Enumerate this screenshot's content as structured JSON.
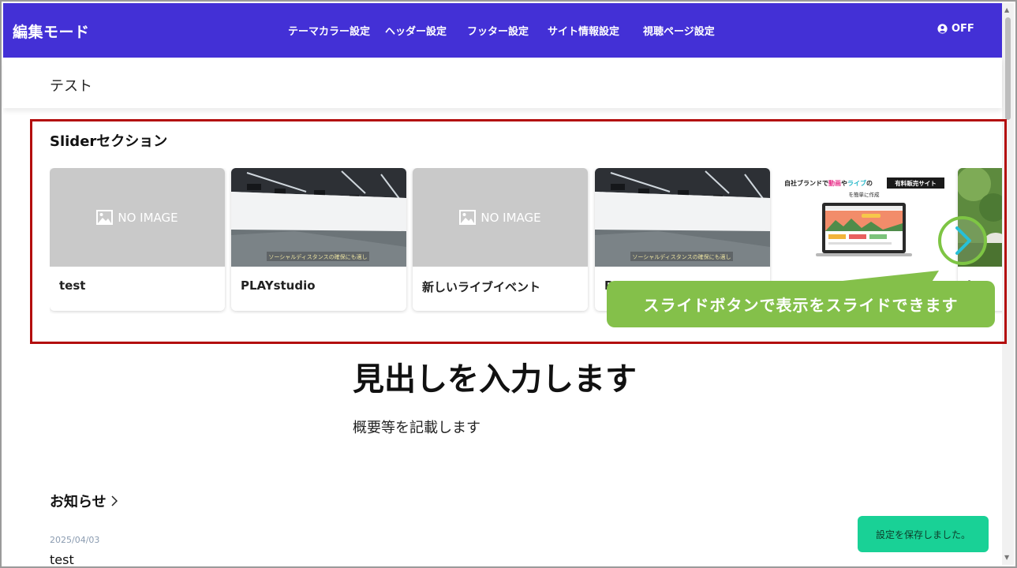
{
  "editbar": {
    "mode_label": "編集モード",
    "nav": [
      "テーマカラー設定",
      "ヘッダー設定",
      "フッター設定",
      "サイト情報設定",
      "視聴ページ設定"
    ],
    "toggle_label": "OFF",
    "background_color": "#4330d6"
  },
  "site_header": {
    "title": "テスト"
  },
  "slider_section": {
    "title": "Sliderセクション",
    "no_image_text": "NO IMAGE",
    "studio_caption": "ソーシャルディスタンスの確保にも適し",
    "promo": {
      "line1_prefix": "自社ブランドで",
      "line1_a": "動画",
      "line1_mid": "や",
      "line1_b": "ライブ",
      "line1_suffix": "の",
      "badge": "有料販売サイト",
      "line2": "を簡単に作成"
    },
    "cards": [
      {
        "label": "test",
        "image": "no-image"
      },
      {
        "label": "PLAYstudio",
        "image": "studio"
      },
      {
        "label": "新しいライブイベント",
        "image": "no-image"
      },
      {
        "label": "P",
        "image": "studio"
      },
      {
        "label": "",
        "image": "promo"
      },
      {
        "label": "bu",
        "image": "nature"
      }
    ],
    "next_button_icon": "chevron-right-icon"
  },
  "callout": {
    "text": "スライドボタンで表示をスライドできます",
    "color": "#84c04a"
  },
  "highlight_color": "#b30d0d",
  "hero": {
    "title": "見出しを入力します",
    "subtitle": "概要等を記載します"
  },
  "news": {
    "title": "お知らせ",
    "date": "2025/04/03",
    "item": "test"
  },
  "toast": {
    "text": "設定を保存しました。",
    "color": "#19d196"
  }
}
